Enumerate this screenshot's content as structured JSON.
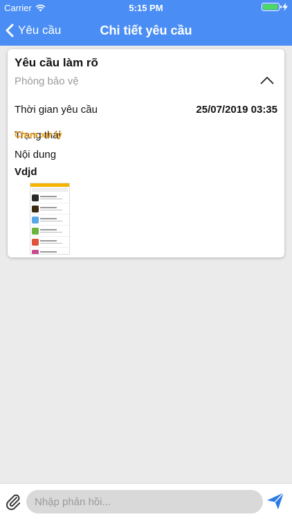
{
  "status_bar": {
    "carrier": "Carrier",
    "time": "5:15 PM",
    "battery_level": 0.95,
    "battery_color": "#4cd964"
  },
  "nav": {
    "back_label": "Yêu cầu",
    "title": "Chi tiết yêu cầu",
    "bar_color": "#4a8ef5"
  },
  "request": {
    "title": "Yêu cầu làm rõ",
    "department": "Phòng bảo vệ",
    "expanded": true,
    "time_label": "Thời gian yêu cầu",
    "time_value": "25/07/2019 03:35",
    "status_label": "Trạng thái",
    "status_value": "Chưa xử lý",
    "status_color": "#f4a31c",
    "content_label": "Nội dung",
    "content_value": "Vdjd",
    "attachment_icon": "screenshot-thumbnail"
  },
  "composer": {
    "placeholder": "Nhập phản hồi...",
    "value": "",
    "attach_icon": "paperclip-icon",
    "send_icon": "send-icon",
    "accent": "#2d7be5"
  }
}
